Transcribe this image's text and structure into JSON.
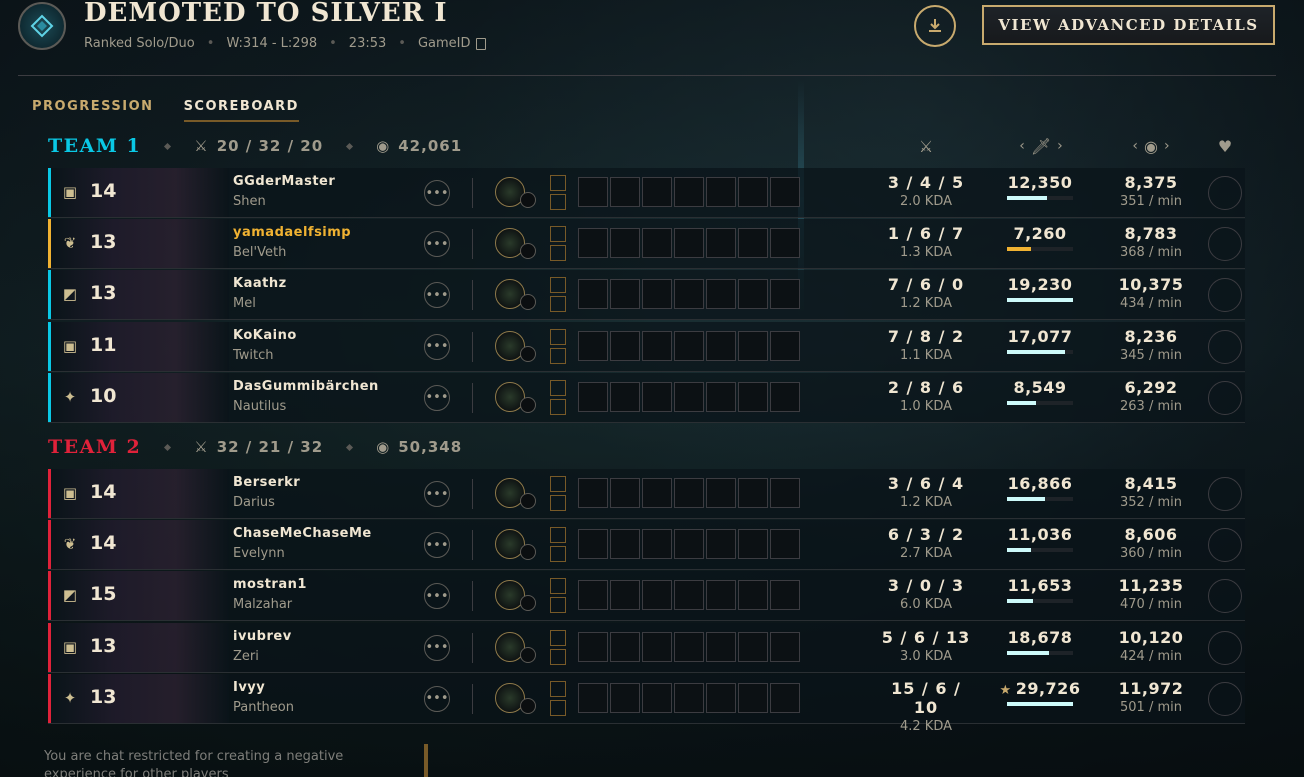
{
  "header": {
    "title": "DEMOTED TO SILVER I",
    "queue": "Ranked Solo/Duo",
    "record": "W:314 - L:298",
    "duration": "23:53",
    "gameid_label": "GameID",
    "advanced_button": "VIEW ADVANCED DETAILS"
  },
  "tabs": [
    {
      "label": "PROGRESSION",
      "active": false
    },
    {
      "label": "SCOREBOARD",
      "active": true
    }
  ],
  "teams": [
    {
      "name": "TEAM 1",
      "kda": "20 / 32 / 20",
      "gold": "42,061",
      "players": [
        {
          "level": "14",
          "name": "GGderMaster",
          "champion": "Shen",
          "kda": "3 / 4 / 5",
          "ratio": "2.0 KDA",
          "damage": "12,350",
          "damage_fraction": 0.6,
          "gold": "8,375",
          "gpm": "351 / min"
        },
        {
          "level": "13",
          "name": "yamadaelfsimp",
          "champion": "Bel'Veth",
          "kda": "1 / 6 / 7",
          "ratio": "1.3 KDA",
          "damage": "7,260",
          "damage_fraction": 0.36,
          "gold": "8,783",
          "gpm": "368 / min",
          "you": true
        },
        {
          "level": "13",
          "name": "Kaathz",
          "champion": "Mel",
          "kda": "7 / 6 / 0",
          "ratio": "1.2 KDA",
          "damage": "19,230",
          "damage_fraction": 1.0,
          "gold": "10,375",
          "gpm": "434 / min"
        },
        {
          "level": "11",
          "name": "KoKaino",
          "champion": "Twitch",
          "kda": "7 / 8 / 2",
          "ratio": "1.1 KDA",
          "damage": "17,077",
          "damage_fraction": 0.88,
          "gold": "8,236",
          "gpm": "345 / min"
        },
        {
          "level": "10",
          "name": "DasGummibärchen",
          "champion": "Nautilus",
          "kda": "2 / 8 / 6",
          "ratio": "1.0 KDA",
          "damage": "8,549",
          "damage_fraction": 0.44,
          "gold": "6,292",
          "gpm": "263 / min"
        }
      ]
    },
    {
      "name": "TEAM 2",
      "kda": "32 / 21 / 32",
      "gold": "50,348",
      "players": [
        {
          "level": "14",
          "name": "Berserkr",
          "champion": "Darius",
          "kda": "3 / 6 / 4",
          "ratio": "1.2 KDA",
          "damage": "16,866",
          "damage_fraction": 0.57,
          "gold": "8,415",
          "gpm": "352 / min"
        },
        {
          "level": "14",
          "name": "ChaseMeChaseMe",
          "champion": "Evelynn",
          "kda": "6 / 3 / 2",
          "ratio": "2.7 KDA",
          "damage": "11,036",
          "damage_fraction": 0.37,
          "gold": "8,606",
          "gpm": "360 / min"
        },
        {
          "level": "15",
          "name": "mostran1",
          "champion": "Malzahar",
          "kda": "3 / 0 / 3",
          "ratio": "6.0 KDA",
          "damage": "11,653",
          "damage_fraction": 0.39,
          "gold": "11,235",
          "gpm": "470 / min"
        },
        {
          "level": "13",
          "name": "ivubrev",
          "champion": "Zeri",
          "kda": "5 / 6 / 13",
          "ratio": "3.0 KDA",
          "damage": "18,678",
          "damage_fraction": 0.63,
          "gold": "10,120",
          "gpm": "424 / min"
        },
        {
          "level": "13",
          "name": "Ivyy",
          "champion": "Pantheon",
          "kda": "15 / 6 / 10",
          "ratio": "4.2 KDA",
          "damage": "29,726",
          "damage_fraction": 1.0,
          "gold": "11,972",
          "gpm": "501 / min",
          "top_damage": true
        }
      ]
    }
  ],
  "footer": {
    "message": "You are chat restricted for creating a negative experience for other players"
  },
  "colors": {
    "team1": "#0ac8e5",
    "team2": "#e0223a",
    "you": "#f0b232",
    "gold_accent": "#c8aa6e"
  },
  "icons": {
    "positions": [
      "top-lane-icon",
      "jungle-icon",
      "mid-lane-icon",
      "bot-lane-icon",
      "support-icon"
    ]
  }
}
